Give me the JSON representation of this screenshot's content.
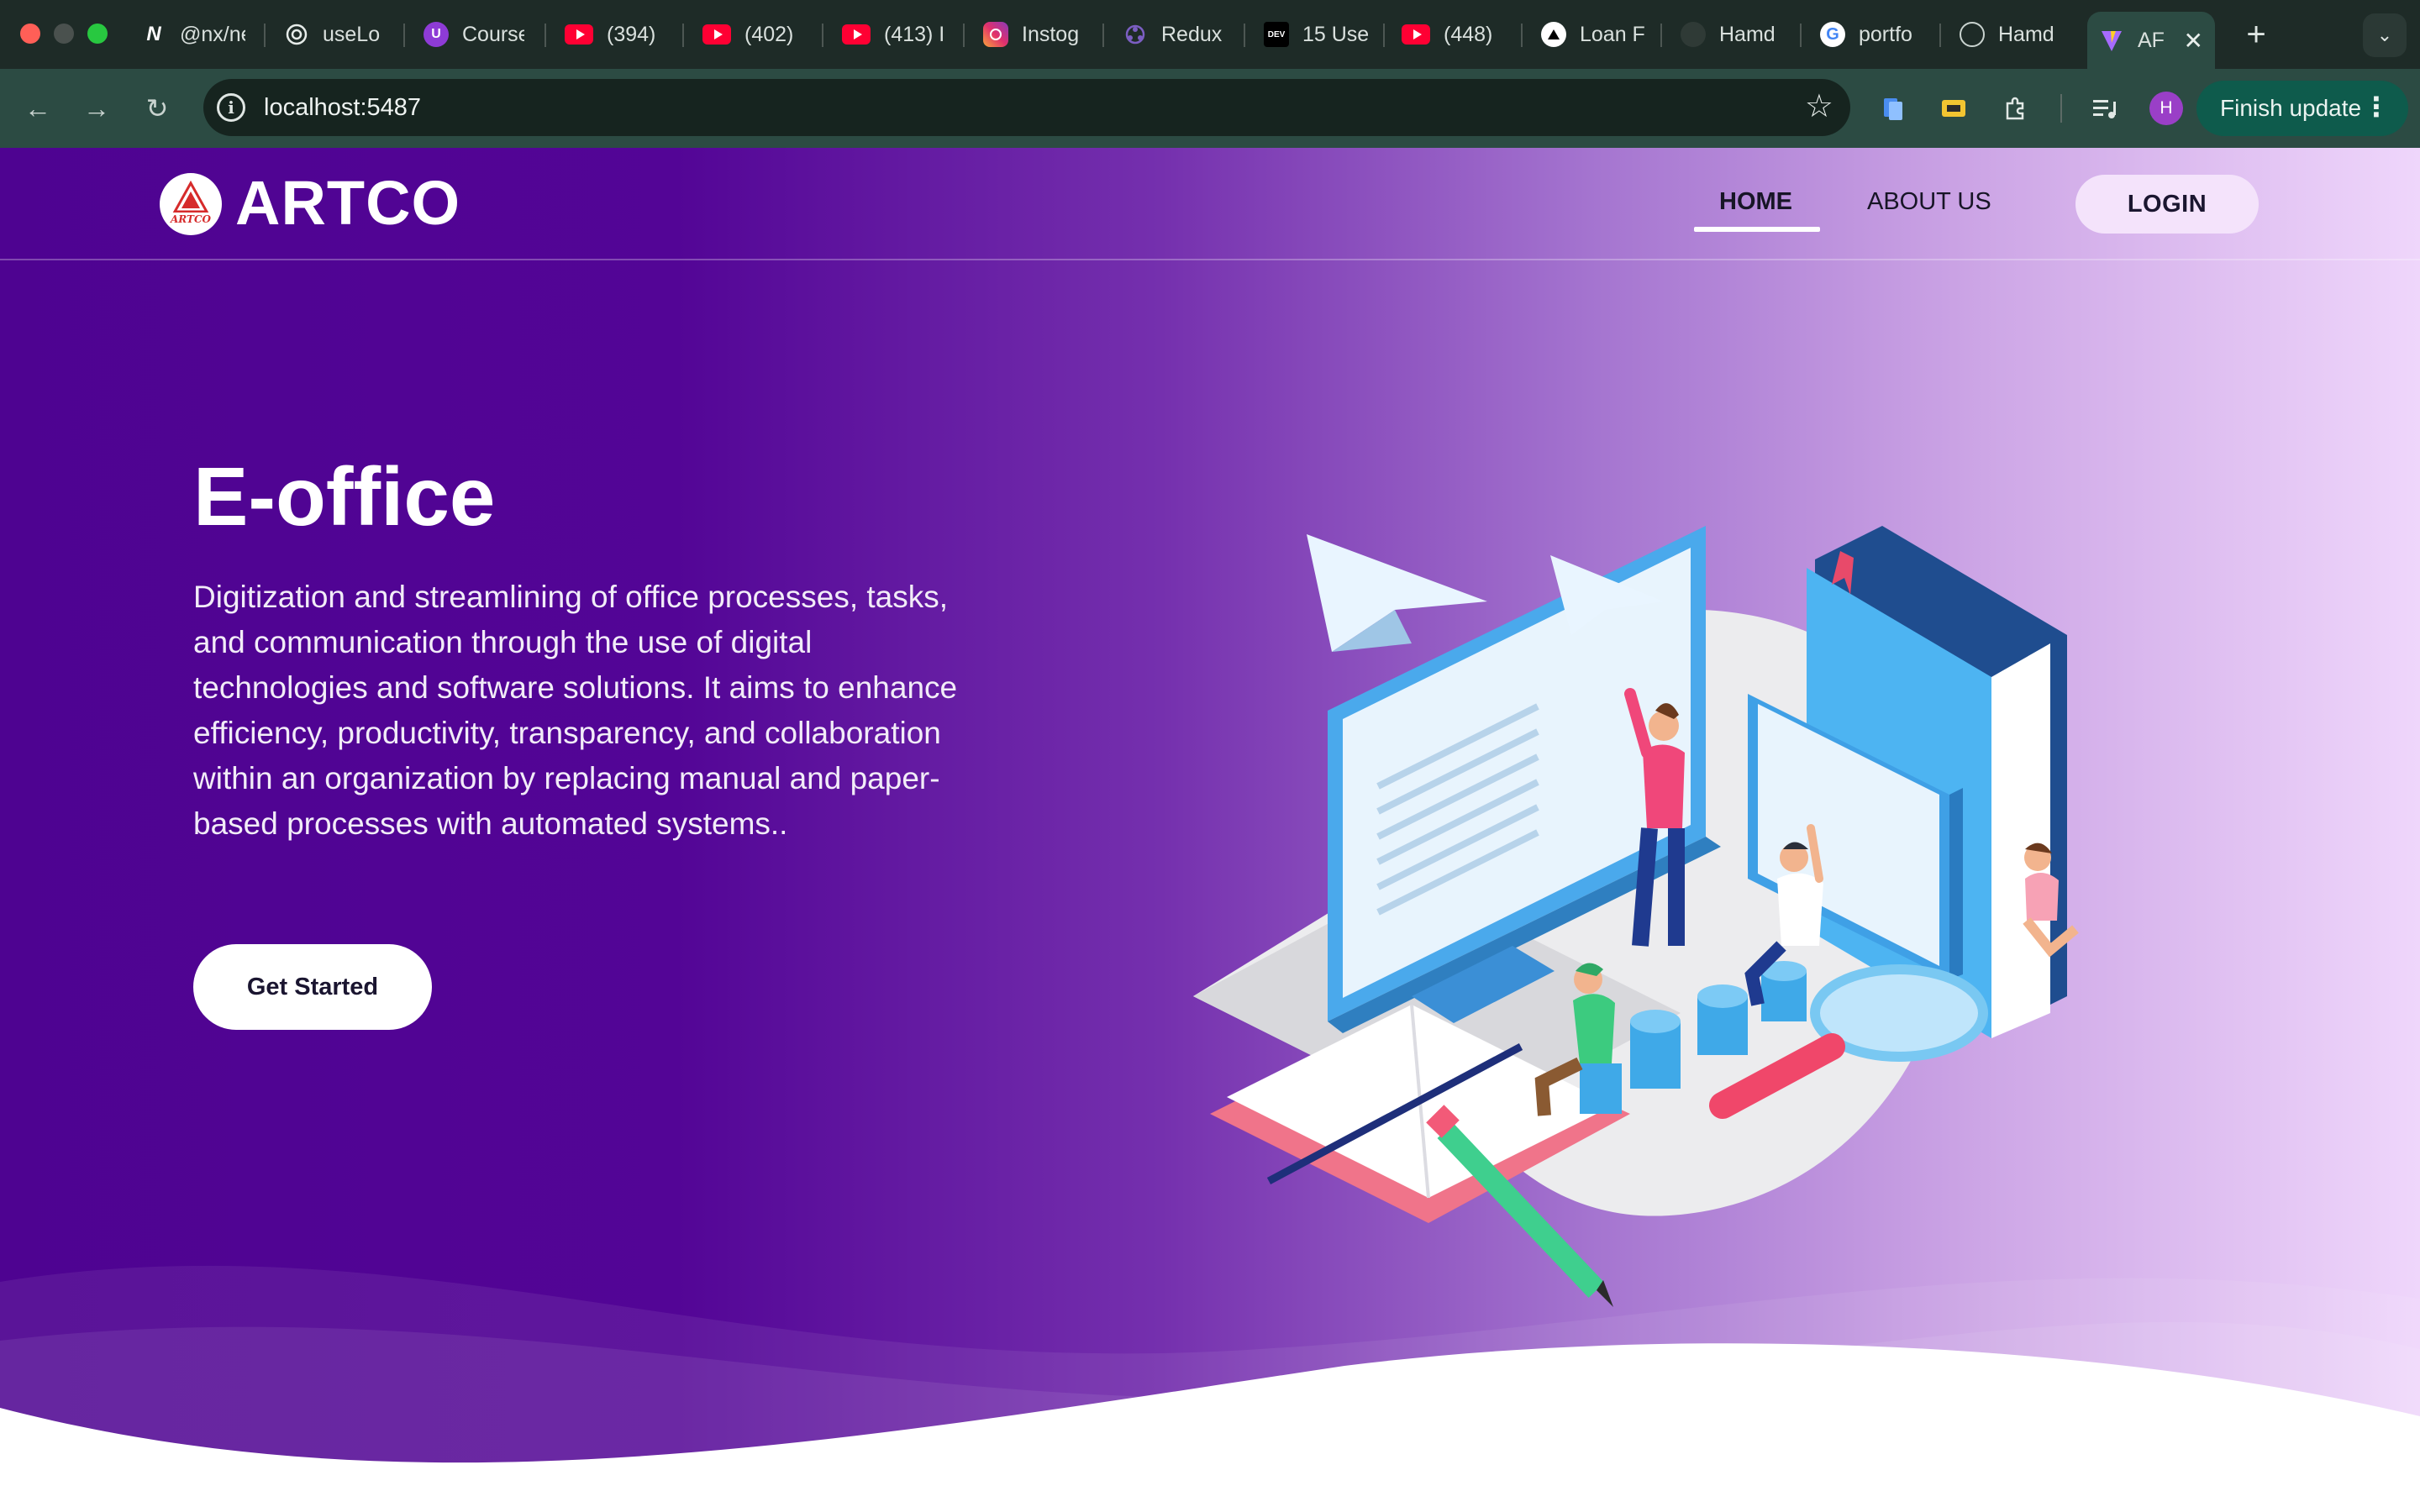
{
  "browser": {
    "tabs": [
      {
        "title": "@nx/ne",
        "icon": "nx-icon"
      },
      {
        "title": "useLo",
        "icon": "openai-icon"
      },
      {
        "title": "Course",
        "icon": "course-icon"
      },
      {
        "title": "(394)",
        "icon": "youtube-icon"
      },
      {
        "title": "(402)",
        "icon": "youtube-icon"
      },
      {
        "title": "(413) I",
        "icon": "youtube-icon"
      },
      {
        "title": "Instog",
        "icon": "instagram-icon"
      },
      {
        "title": "Redux",
        "icon": "redux-icon"
      },
      {
        "title": "15 Use",
        "icon": "dev-icon"
      },
      {
        "title": "(448)",
        "icon": "youtube-icon"
      },
      {
        "title": "Loan F",
        "icon": "vercel-icon"
      },
      {
        "title": "Hamd",
        "icon": "github-icon"
      },
      {
        "title": "portfo",
        "icon": "google-icon"
      },
      {
        "title": "Hamd",
        "icon": "globe-icon"
      },
      {
        "title": "AF",
        "icon": "vite-icon",
        "active": true
      }
    ],
    "dev_badge": "DEV",
    "url": "localhost:5487",
    "profile_initial": "H",
    "finish_update_label": "Finish update",
    "accent": "#0e5b4c"
  },
  "site": {
    "brand": "ARTCO",
    "logo_text": "ARTCO",
    "nav": {
      "home": "HOME",
      "about": "ABOUT US",
      "login": "LOGIN"
    },
    "hero": {
      "title": "E-office",
      "description": "Digitization and streamlining of office processes, tasks, and communication through the use of digital technologies and software solutions. It aims to enhance efficiency, productivity, transparency, and collaboration within an organization by replacing manual and paper-based processes with automated systems..",
      "cta": "Get Started"
    },
    "colors": {
      "gradient_start": "#4e0391",
      "gradient_end": "#efd6fb",
      "logo_red": "#d62b2b"
    }
  }
}
